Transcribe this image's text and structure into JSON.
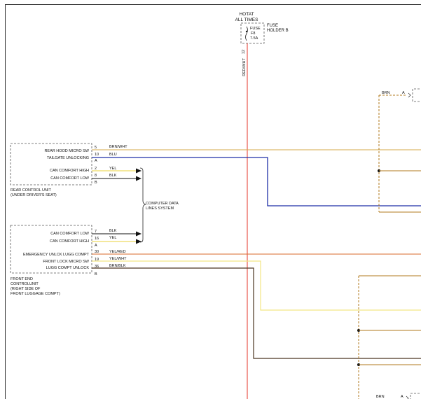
{
  "fuse": {
    "hot_line1": "HOTAT",
    "hot_line2": "ALL TIMES",
    "holder_line1": "FUSE",
    "holder_line2": "HOLDER B",
    "inner_line1": "FUSE",
    "inner_line2": "F8",
    "inner_line3": "7.5A",
    "pin": "12",
    "wire_color": "RED/WHT"
  },
  "rear_unit": {
    "label_line1": "REAR CONTROL UNIT",
    "label_line2": "(UNDER DRIVER'S SEAT)",
    "pins": [
      {
        "name": "REAR HOOD MICRO SW",
        "num": "5",
        "wire": "BRN/WHT"
      },
      {
        "name": "TAILGATE UNLOCKING",
        "num": "10",
        "wire": "BLU"
      },
      {
        "name": "CAN COMFORT HIGH",
        "num": "2",
        "wire": "YEL"
      },
      {
        "name": "CAN COMFORT LOW",
        "num": "8",
        "wire": "BLK"
      }
    ],
    "connectors": [
      "A",
      "B"
    ]
  },
  "front_unit": {
    "label_line1": "FRONT END",
    "label_line2": "CONTROLUNIT",
    "label_line3": "(RIGHT SIDE OF",
    "label_line4": "FRONT LUGGAGE COMPT)",
    "can_pins": [
      {
        "name": "CAN COMFORT LOW",
        "num": "7",
        "wire": "BLK"
      },
      {
        "name": "CAN COMFORT HIGH",
        "num": "16",
        "wire": "YEL"
      }
    ],
    "io_pins": [
      {
        "name": "EMERGENCY UNLCK LUGG COMPT",
        "num": "30",
        "wire": "YEL/RED"
      },
      {
        "name": "FRONT LOCK MICRO SW",
        "num": "19",
        "wire": "YEL/WHT"
      },
      {
        "name": "LUGG COMPT UNLOCK",
        "num": "36",
        "wire": "BRN/BLK"
      }
    ],
    "connectors": [
      "A",
      "B"
    ]
  },
  "bus_label": {
    "line1": "COMPUTER DATA",
    "line2": "LINES SYSTEM"
  },
  "right_connectors": {
    "top_wire": "BRN",
    "top_conn": "A",
    "bottom_wire": "BRN",
    "bottom_conn": "A"
  },
  "colors": {
    "red_wht": "#e8483c",
    "brn_wht": "#d4a84a",
    "blu": "#1f2fa8",
    "yel": "#e9d23a",
    "blk": "#111111",
    "yel_red": "#d96a2a",
    "yel_wht": "#f2e684",
    "brn_blk": "#4a3520",
    "brn": "#b07a1c",
    "frame": "#333333",
    "dash": "#555555"
  }
}
